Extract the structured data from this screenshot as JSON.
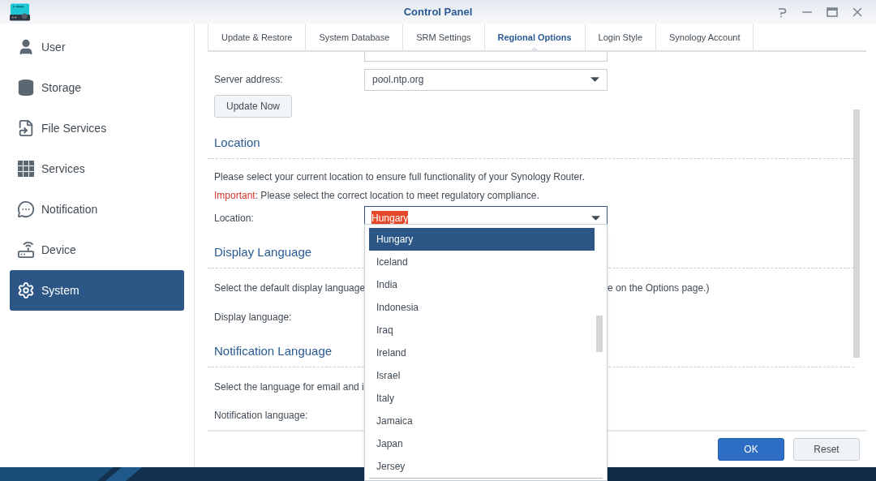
{
  "window": {
    "title": "Control Panel"
  },
  "sidebar": {
    "items": [
      {
        "label": "User",
        "selected": false
      },
      {
        "label": "Storage",
        "selected": false
      },
      {
        "label": "File Services",
        "selected": false
      },
      {
        "label": "Services",
        "selected": false
      },
      {
        "label": "Notification",
        "selected": false
      },
      {
        "label": "Device",
        "selected": false
      },
      {
        "label": "System",
        "selected": true
      }
    ]
  },
  "tabs": [
    {
      "label": "Update & Restore",
      "selected": false
    },
    {
      "label": "System Database",
      "selected": false
    },
    {
      "label": "SRM Settings",
      "selected": false
    },
    {
      "label": "Regional Options",
      "selected": true
    },
    {
      "label": "Login Style",
      "selected": false
    },
    {
      "label": "Synology Account",
      "selected": false
    }
  ],
  "time_server": {
    "label": "Server address:",
    "value": "pool.ntp.org",
    "button": "Update Now"
  },
  "location": {
    "heading": "Location",
    "description": "Please select your current location to ensure full functionality of your Synology Router.",
    "important": "Important",
    "important_text": ": Please select the correct location to meet regulatory compliance.",
    "label": "Location:",
    "value": "Hungary",
    "value_highlighted": true,
    "options": [
      {
        "label": "Hungary",
        "selected": true
      },
      {
        "label": "Iceland",
        "selected": false
      },
      {
        "label": "India",
        "selected": false
      },
      {
        "label": "Indonesia",
        "selected": false
      },
      {
        "label": "Iraq",
        "selected": false
      },
      {
        "label": "Ireland",
        "selected": false
      },
      {
        "label": "Israel",
        "selected": false
      },
      {
        "label": "Italy",
        "selected": false
      },
      {
        "label": "Jamaica",
        "selected": false
      },
      {
        "label": "Japan",
        "selected": false
      },
      {
        "label": "Jersey",
        "selected": false
      }
    ]
  },
  "display_language": {
    "heading": "Display Language",
    "description_left": "Select the default display language",
    "description_right": "e on the Options page.)",
    "label": "Display language:"
  },
  "notification_language": {
    "heading": "Notification Language",
    "description_left": "Select the language for email and i",
    "label": "Notification language:"
  },
  "buttons": [
    {
      "label": "OK",
      "kind": "primary"
    },
    {
      "label": "Reset",
      "kind": "secondary"
    }
  ]
}
